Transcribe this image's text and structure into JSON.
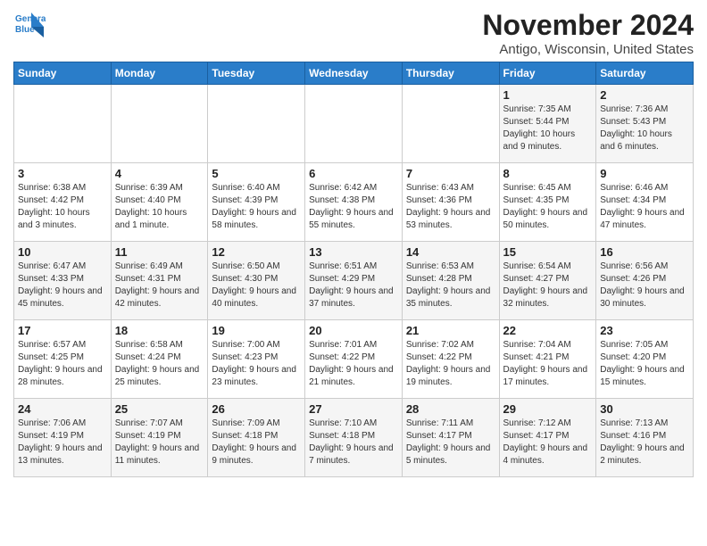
{
  "logo": {
    "line1": "General",
    "line2": "Blue"
  },
  "header": {
    "month": "November 2024",
    "location": "Antigo, Wisconsin, United States"
  },
  "weekdays": [
    "Sunday",
    "Monday",
    "Tuesday",
    "Wednesday",
    "Thursday",
    "Friday",
    "Saturday"
  ],
  "weeks": [
    [
      {
        "day": "",
        "info": ""
      },
      {
        "day": "",
        "info": ""
      },
      {
        "day": "",
        "info": ""
      },
      {
        "day": "",
        "info": ""
      },
      {
        "day": "",
        "info": ""
      },
      {
        "day": "1",
        "info": "Sunrise: 7:35 AM\nSunset: 5:44 PM\nDaylight: 10 hours and 9 minutes."
      },
      {
        "day": "2",
        "info": "Sunrise: 7:36 AM\nSunset: 5:43 PM\nDaylight: 10 hours and 6 minutes."
      }
    ],
    [
      {
        "day": "3",
        "info": "Sunrise: 6:38 AM\nSunset: 4:42 PM\nDaylight: 10 hours and 3 minutes."
      },
      {
        "day": "4",
        "info": "Sunrise: 6:39 AM\nSunset: 4:40 PM\nDaylight: 10 hours and 1 minute."
      },
      {
        "day": "5",
        "info": "Sunrise: 6:40 AM\nSunset: 4:39 PM\nDaylight: 9 hours and 58 minutes."
      },
      {
        "day": "6",
        "info": "Sunrise: 6:42 AM\nSunset: 4:38 PM\nDaylight: 9 hours and 55 minutes."
      },
      {
        "day": "7",
        "info": "Sunrise: 6:43 AM\nSunset: 4:36 PM\nDaylight: 9 hours and 53 minutes."
      },
      {
        "day": "8",
        "info": "Sunrise: 6:45 AM\nSunset: 4:35 PM\nDaylight: 9 hours and 50 minutes."
      },
      {
        "day": "9",
        "info": "Sunrise: 6:46 AM\nSunset: 4:34 PM\nDaylight: 9 hours and 47 minutes."
      }
    ],
    [
      {
        "day": "10",
        "info": "Sunrise: 6:47 AM\nSunset: 4:33 PM\nDaylight: 9 hours and 45 minutes."
      },
      {
        "day": "11",
        "info": "Sunrise: 6:49 AM\nSunset: 4:31 PM\nDaylight: 9 hours and 42 minutes."
      },
      {
        "day": "12",
        "info": "Sunrise: 6:50 AM\nSunset: 4:30 PM\nDaylight: 9 hours and 40 minutes."
      },
      {
        "day": "13",
        "info": "Sunrise: 6:51 AM\nSunset: 4:29 PM\nDaylight: 9 hours and 37 minutes."
      },
      {
        "day": "14",
        "info": "Sunrise: 6:53 AM\nSunset: 4:28 PM\nDaylight: 9 hours and 35 minutes."
      },
      {
        "day": "15",
        "info": "Sunrise: 6:54 AM\nSunset: 4:27 PM\nDaylight: 9 hours and 32 minutes."
      },
      {
        "day": "16",
        "info": "Sunrise: 6:56 AM\nSunset: 4:26 PM\nDaylight: 9 hours and 30 minutes."
      }
    ],
    [
      {
        "day": "17",
        "info": "Sunrise: 6:57 AM\nSunset: 4:25 PM\nDaylight: 9 hours and 28 minutes."
      },
      {
        "day": "18",
        "info": "Sunrise: 6:58 AM\nSunset: 4:24 PM\nDaylight: 9 hours and 25 minutes."
      },
      {
        "day": "19",
        "info": "Sunrise: 7:00 AM\nSunset: 4:23 PM\nDaylight: 9 hours and 23 minutes."
      },
      {
        "day": "20",
        "info": "Sunrise: 7:01 AM\nSunset: 4:22 PM\nDaylight: 9 hours and 21 minutes."
      },
      {
        "day": "21",
        "info": "Sunrise: 7:02 AM\nSunset: 4:22 PM\nDaylight: 9 hours and 19 minutes."
      },
      {
        "day": "22",
        "info": "Sunrise: 7:04 AM\nSunset: 4:21 PM\nDaylight: 9 hours and 17 minutes."
      },
      {
        "day": "23",
        "info": "Sunrise: 7:05 AM\nSunset: 4:20 PM\nDaylight: 9 hours and 15 minutes."
      }
    ],
    [
      {
        "day": "24",
        "info": "Sunrise: 7:06 AM\nSunset: 4:19 PM\nDaylight: 9 hours and 13 minutes."
      },
      {
        "day": "25",
        "info": "Sunrise: 7:07 AM\nSunset: 4:19 PM\nDaylight: 9 hours and 11 minutes."
      },
      {
        "day": "26",
        "info": "Sunrise: 7:09 AM\nSunset: 4:18 PM\nDaylight: 9 hours and 9 minutes."
      },
      {
        "day": "27",
        "info": "Sunrise: 7:10 AM\nSunset: 4:18 PM\nDaylight: 9 hours and 7 minutes."
      },
      {
        "day": "28",
        "info": "Sunrise: 7:11 AM\nSunset: 4:17 PM\nDaylight: 9 hours and 5 minutes."
      },
      {
        "day": "29",
        "info": "Sunrise: 7:12 AM\nSunset: 4:17 PM\nDaylight: 9 hours and 4 minutes."
      },
      {
        "day": "30",
        "info": "Sunrise: 7:13 AM\nSunset: 4:16 PM\nDaylight: 9 hours and 2 minutes."
      }
    ]
  ]
}
